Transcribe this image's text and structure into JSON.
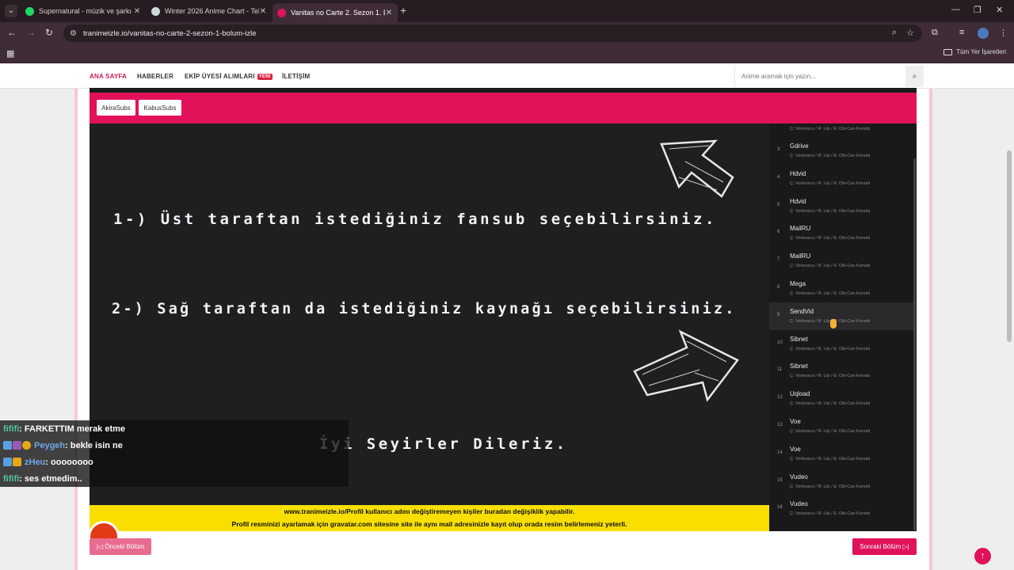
{
  "browser": {
    "tabs": [
      {
        "title": "Supernatural - müzik ve şarkı sö",
        "favicon_color": "#1ed760",
        "active": false
      },
      {
        "title": "Winter 2026 Anime Chart - Tele",
        "favicon_color": "#cfd8dc",
        "active": false
      },
      {
        "title": "Vanitas no Carte 2. Sezon 1. Bö",
        "favicon_color": "#e0125a",
        "active": true
      }
    ],
    "url": "tranimeizle.io/vanitas-no-carte-2-sezon-1-bolum-izle",
    "bookmarks_label": "Tüm Yer İşaretleri"
  },
  "site": {
    "nav": {
      "home": "ANA SAYFA",
      "news": "HABERLER",
      "staff": "EKİP ÜYESİ ALIMLARI",
      "staff_badge": "YENİ",
      "contact": "İLETİŞİM"
    },
    "search_placeholder": "Anime aramak için yazın..."
  },
  "fansubs": [
    "AkiraSubs",
    "KabusSubs"
  ],
  "video_text": {
    "line1": "1-) Üst taraftan istediğiniz fansub seçebilirsiniz.",
    "line2": "2-) Sağ taraftan da istediğiniz kaynağı seçebilirsiniz.",
    "line3": "İyi Seyirler Dileriz."
  },
  "sources": {
    "partial_credit": "Ç: Vorlessco / R: Lily / E: Obi-Can Kenobi",
    "items": [
      {
        "num": "3",
        "name": "Gdrive",
        "credit": "Ç: Vorlessco / R: Lily / E: Obi-Can Kenobi"
      },
      {
        "num": "4",
        "name": "Hdvid",
        "credit": "Ç: Vorlessco / R: Lily / E: Obi-Can Kenobi"
      },
      {
        "num": "5",
        "name": "Hdvid",
        "credit": "Ç: Vorlessco / R: Lily / E: Obi-Can Kenobi"
      },
      {
        "num": "6",
        "name": "MailRU",
        "credit": "Ç: Vorlessco / R: Lily / E: Obi-Can Kenobi"
      },
      {
        "num": "7",
        "name": "MailRU",
        "credit": "Ç: Vorlessco / R: Lily / E: Obi-Can Kenobi"
      },
      {
        "num": "8",
        "name": "Mega",
        "credit": "Ç: Vorlessco / R: Lily / E: Obi-Can Kenobi"
      },
      {
        "num": "9",
        "name": "SendVid",
        "credit": "Ç: Vorlessco / R: Lily / E: Obi-Can Kenobi"
      },
      {
        "num": "10",
        "name": "Sibnet",
        "credit": "Ç: Vorlessco / R: Lily / E: Obi-Can Kenobi"
      },
      {
        "num": "11",
        "name": "Sibnet",
        "credit": "Ç: Vorlessco / R: Lily / E: Obi-Can Kenobi"
      },
      {
        "num": "12",
        "name": "Uqload",
        "credit": "Ç: Vorlessco / R: Lily / E: Obi-Can Kenobi"
      },
      {
        "num": "13",
        "name": "Voe",
        "credit": "Ç: Vorlessco / R: Lily / E: Obi-Can Kenobi"
      },
      {
        "num": "14",
        "name": "Voe",
        "credit": "Ç: Vorlessco / R: Lily / E: Obi-Can Kenobi"
      },
      {
        "num": "15",
        "name": "Vudeo",
        "credit": "Ç: Vorlessco / R: Lily / E: Obi-Can Kenobi"
      },
      {
        "num": "16",
        "name": "Vudeo",
        "credit": "Ç: Vorlessco / R: Lily / E: Obi-Can Kenobi"
      }
    ]
  },
  "notice": {
    "line1": "www.tranimeizle.io/Profil kullanıcı adını değiştiremeyen kişiler buradan değişiklik yapabilir.",
    "line2": "Profil resminizi ayarlamak için gravatar.com sitesine site ile aynı mail adresinizle kayıt olup orada resim belirlemeniz yeterli."
  },
  "pager": {
    "prev": "|◁ Önceki Bölüm",
    "next": "Sonraki Bölüm ▷|"
  },
  "chat": [
    {
      "user": "fififi",
      "msg": ": FARKETTIM merak etme"
    },
    {
      "user": "Peygeh",
      "msg": ": bekle isin ne"
    },
    {
      "user": "zHeu",
      "msg": ": oooooooo"
    },
    {
      "user": "fififi",
      "msg": ": ses etmedim.."
    }
  ],
  "colors": {
    "brand": "#e2125a",
    "notice": "#f8df00",
    "video_bg": "#1f1f21"
  }
}
